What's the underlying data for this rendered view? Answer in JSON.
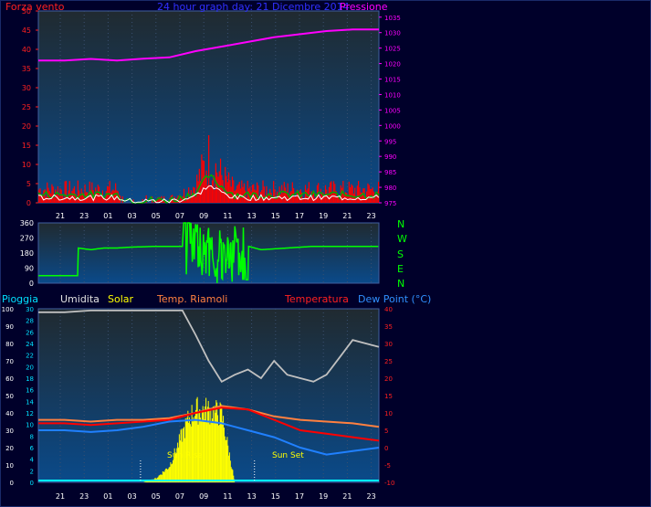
{
  "header": {
    "left_label": "Forza vento",
    "center_title": "24 hour graph day:  21 Dicembre 2014",
    "right_label": "Pressione"
  },
  "legend_bottom": {
    "pioggia": "Pioggia",
    "umidita": "Umidita",
    "solar": "Solar",
    "temp_riamoli": "Temp. Riamoli",
    "temperatura": "Temperatura",
    "dew_point": "Dew Point (°C)"
  },
  "compass": [
    "N",
    "W",
    "S",
    "E",
    "N"
  ],
  "annotations": {
    "sun_rise": "Sun Rise",
    "sun_set": "Sun Set"
  },
  "colors": {
    "wind": "#ff0000",
    "gust_white": "#ffffff",
    "wind_green": "#00aa00",
    "pressure": "#ff00ff",
    "direction": "#00ff00",
    "humidity": "#c0c0c0",
    "temp_riamoli": "#ff8040",
    "temperatura": "#ff0000",
    "dew": "#2080ff",
    "solar": "#ffff00",
    "rain": "#00ffff"
  },
  "chart_data": [
    {
      "type": "line",
      "name": "wind-pressure",
      "x_tick_labels": [
        "21",
        "23",
        "01",
        "03",
        "05",
        "07",
        "09",
        "11",
        "13",
        "15",
        "17",
        "19",
        "21",
        "23"
      ],
      "left_axis": {
        "title": "Forza vento",
        "ticks": [
          0,
          5,
          10,
          15,
          20,
          25,
          30,
          35,
          40,
          45,
          50
        ],
        "ylim": [
          0,
          50
        ]
      },
      "right_axis": {
        "title": "Pressione",
        "ticks": [
          975,
          980,
          985,
          990,
          995,
          1000,
          1005,
          1010,
          1015,
          1020,
          1025,
          1030,
          1035
        ],
        "ylim": [
          975,
          1037
        ]
      },
      "pressure": {
        "x": [
          0,
          2,
          4,
          6,
          8,
          10,
          12,
          14,
          16,
          18,
          20,
          22,
          24,
          26
        ],
        "values": [
          1021,
          1021,
          1021.5,
          1021,
          1021.6,
          1022,
          1024,
          1025.5,
          1027,
          1028.5,
          1029.5,
          1030.5,
          1031,
          1031
        ]
      },
      "wind_base": {
        "x": [
          0,
          2,
          4,
          6,
          7,
          8,
          10,
          11,
          12,
          13,
          14,
          15,
          16,
          18,
          20,
          22,
          24,
          26
        ],
        "values": [
          3,
          3,
          3,
          3,
          1,
          1,
          1,
          2,
          4,
          10,
          6,
          3,
          3,
          3,
          3,
          3,
          3,
          3
        ]
      }
    },
    {
      "type": "line",
      "name": "wind-direction",
      "y_ticks": [
        0,
        90,
        180,
        270,
        360
      ],
      "ylim": [
        0,
        360
      ],
      "x": [
        0,
        3,
        3.05,
        4,
        5,
        6,
        7,
        9,
        11,
        11.1,
        12,
        12.5,
        13,
        13.5,
        14,
        14.5,
        15,
        15.5,
        16,
        16.05,
        17,
        19,
        21,
        22,
        24,
        26
      ],
      "values": [
        45,
        45,
        210,
        200,
        210,
        210,
        215,
        220,
        220,
        360,
        360,
        80,
        330,
        40,
        290,
        60,
        340,
        20,
        20,
        220,
        200,
        210,
        220,
        220,
        220,
        220
      ]
    },
    {
      "type": "line",
      "name": "weather",
      "rain_axis": {
        "title": "Pioggia",
        "ticks": [
          0,
          2,
          4,
          6,
          8,
          10,
          12,
          14,
          16,
          18,
          20,
          22,
          24,
          26,
          28,
          30
        ],
        "ylim": [
          0,
          30
        ]
      },
      "humidity_axis": {
        "title": "Umidita",
        "ticks": [
          0,
          10,
          20,
          30,
          40,
          50,
          60,
          70,
          80,
          90,
          100
        ],
        "ylim": [
          0,
          100
        ]
      },
      "temp_axis": {
        "title": "Dew Point (°C)",
        "ticks": [
          -10,
          -5,
          0,
          5,
          10,
          15,
          20,
          25,
          30,
          35,
          40
        ],
        "ylim": [
          -10,
          40
        ]
      },
      "humidity": {
        "x": [
          0,
          2,
          4,
          6,
          8,
          10,
          11,
          12,
          13,
          14,
          15,
          16,
          17,
          18,
          19,
          20,
          21,
          22,
          23,
          24,
          25,
          26
        ],
        "values": [
          98,
          98,
          99,
          99,
          99,
          99,
          99,
          85,
          70,
          58,
          62,
          65,
          60,
          70,
          62,
          60,
          58,
          62,
          72,
          82,
          80,
          78
        ]
      },
      "temp_riamoli": {
        "x": [
          0,
          2,
          4,
          6,
          8,
          10,
          12,
          14,
          16,
          18,
          20,
          22,
          24,
          26
        ],
        "values": [
          8,
          8,
          7.5,
          8,
          8,
          8.5,
          10,
          12,
          11,
          9,
          8,
          7.5,
          7,
          6
        ]
      },
      "temperatura": {
        "x": [
          0,
          2,
          4,
          6,
          8,
          10,
          12,
          14,
          16,
          18,
          20,
          22,
          24,
          26
        ],
        "values": [
          7,
          7,
          6.5,
          7,
          7.5,
          8,
          10,
          11.5,
          11,
          8,
          5,
          4,
          3,
          2
        ]
      },
      "dew_point": {
        "x": [
          0,
          2,
          4,
          6,
          8,
          10,
          12,
          14,
          16,
          18,
          20,
          22,
          24,
          26
        ],
        "values": [
          5,
          5,
          4.5,
          5,
          6,
          7.5,
          8,
          7,
          5,
          3,
          0,
          -2,
          -1,
          0
        ]
      },
      "solar": {
        "x": [
          8,
          9,
          10,
          11,
          11.5,
          12,
          13,
          14,
          15,
          16,
          17
        ],
        "values": [
          0,
          1,
          4,
          12,
          16,
          18,
          18,
          17,
          0,
          0,
          0
        ]
      }
    }
  ]
}
